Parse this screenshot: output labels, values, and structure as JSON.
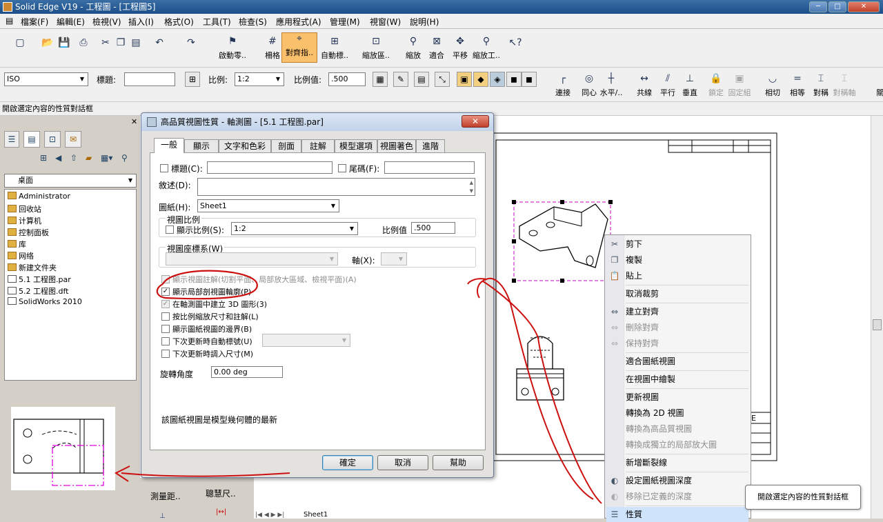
{
  "window": {
    "title": "Solid Edge V19 - 工程圖 - [工程圖5]",
    "min": "─",
    "max": "□",
    "close": "✕"
  },
  "menu": [
    "檔案(F)",
    "編輯(E)",
    "檢視(V)",
    "插入(I)",
    "格式(O)",
    "工具(T)",
    "檢查(S)",
    "應用程式(A)",
    "管理(M)",
    "視窗(W)",
    "說明(H)"
  ],
  "toolbar1": [
    {
      "label": "啟動零..",
      "icon": "start-part-icon"
    },
    {
      "label": "柵格",
      "icon": "grid-icon"
    },
    {
      "label": "對齊指..",
      "icon": "align-icon"
    },
    {
      "label": "自動標..",
      "icon": "auto-label-icon"
    },
    {
      "label": "縮放區..",
      "icon": "zoom-area-icon"
    },
    {
      "label": "縮放",
      "icon": "zoom-icon"
    },
    {
      "label": "適合",
      "icon": "fit-icon"
    },
    {
      "label": "平移",
      "icon": "pan-icon"
    },
    {
      "label": "縮放工..",
      "icon": "zoom-tool-icon"
    }
  ],
  "toolbar2": {
    "standard": "ISO",
    "title_label": "標題:",
    "title_value": "",
    "scale_label": "比例:",
    "scale_value": "1:2",
    "scale_num_label": "比例值:",
    "scale_num_value": ".500"
  },
  "constraints": [
    {
      "label": "連接",
      "glyph": "┌",
      "disabled": false
    },
    {
      "label": "同心",
      "glyph": "◎",
      "disabled": false
    },
    {
      "label": "水平/..",
      "glyph": "┼",
      "disabled": false
    },
    {
      "label": "共線",
      "glyph": "↔",
      "disabled": false
    },
    {
      "label": "平行",
      "glyph": "⫽",
      "disabled": false
    },
    {
      "label": "垂直",
      "glyph": "⊥",
      "disabled": false
    },
    {
      "label": "鎖定",
      "glyph": "🔒",
      "disabled": true
    },
    {
      "label": "固定組",
      "glyph": "▣",
      "disabled": true
    },
    {
      "label": "相切",
      "glyph": "◡",
      "disabled": false
    },
    {
      "label": "相等",
      "glyph": "=",
      "disabled": false
    },
    {
      "label": "對稱",
      "glyph": "⌶",
      "disabled": false
    },
    {
      "label": "對稱軸",
      "glyph": "⌶",
      "disabled": true
    },
    {
      "label": "關(",
      "glyph": "",
      "disabled": false
    }
  ],
  "status": "開啟選定內容的性質對話框",
  "left": {
    "location": "桌面",
    "files": [
      "Administrator",
      "回收站",
      "计算机",
      "控制面板",
      "库",
      "网络",
      "新建文件夹",
      "5.1 工程图.par",
      "5.2 工程图.dft",
      "SolidWorks 2010"
    ]
  },
  "bottomtools": {
    "measure": "測量距..",
    "smart": "聰慧尺.."
  },
  "sheet_tab": "Sheet1",
  "dialog": {
    "title": "高品質視圖性質 - 軸測圖 - [5.1 工程图.par]",
    "tabs": [
      "一般",
      "顯示",
      "文字和色彩",
      "剖面",
      "註解",
      "模型選項",
      "視圖著色",
      "進階"
    ],
    "title_chk": "標題(C):",
    "suffix_chk": "尾碼(F):",
    "desc_label": "敘述(D):",
    "sheet_label": "圖紙(H):",
    "sheet_value": "Sheet1",
    "view_scale_group": "視圖比例",
    "show_scale": "顯示比例(S):",
    "view_scale_value": "1:2",
    "scale_value_label": "比例值",
    "scale_value": ".500",
    "coord_group": "視圖座標系(W)",
    "axis_label": "軸(X):",
    "opt_annot": "顯示視圖註解(切割平面、局部放大區域、檢視平面)(A)",
    "opt_local": "顯示局部剖視圖輪廓(P)",
    "opt_3d": "在軸測圖中建立 3D 圖形(3)",
    "opt_scale": "按比例縮放尺寸和註解(L)",
    "opt_border": "顯示圖紙視圖的邊界(B)",
    "opt_auto": "下次更新時自動標號(U)",
    "opt_dim": "下次更新時調入尺寸(M)",
    "rotate_label": "旋轉角度",
    "rotate_value": "0.00 deg",
    "info": "該圖紙視圖是模型幾何體的最新",
    "ok": "確定",
    "cancel": "取消",
    "help": "幫助",
    "close_glyph": "✕"
  },
  "context_menu": [
    {
      "label": "剪下",
      "icon": "scissors-icon",
      "glyph": "✂",
      "disabled": false
    },
    {
      "label": "複製",
      "icon": "copy-icon",
      "glyph": "❐",
      "disabled": false
    },
    {
      "label": "貼上",
      "icon": "paste-icon",
      "glyph": "📋",
      "disabled": false
    },
    {
      "sep": true
    },
    {
      "label": "取消裁剪",
      "disabled": false
    },
    {
      "sep": true
    },
    {
      "label": "建立對齊",
      "icon": "create-align-icon",
      "glyph": "⇔",
      "disabled": false
    },
    {
      "label": "刪除對齊",
      "icon": "delete-align-icon",
      "glyph": "⇔",
      "disabled": true
    },
    {
      "label": "保持對齊",
      "icon": "keep-align-icon",
      "glyph": "⇔",
      "disabled": true
    },
    {
      "sep": true
    },
    {
      "label": "適合圖紙視圖",
      "disabled": false
    },
    {
      "sep": true
    },
    {
      "label": "在視圖中繪製",
      "disabled": false
    },
    {
      "sep": true
    },
    {
      "label": "更新視圖",
      "disabled": false
    },
    {
      "label": "轉換為 2D 視圖",
      "disabled": false
    },
    {
      "label": "轉換為高品質視圖",
      "disabled": true
    },
    {
      "label": "轉換成獨立的局部放大圖",
      "disabled": true
    },
    {
      "sep": true
    },
    {
      "label": "新增斷裂線",
      "disabled": false
    },
    {
      "sep": true
    },
    {
      "label": "設定圖紙視圖深度",
      "icon": "depth-icon",
      "glyph": "◐",
      "disabled": false
    },
    {
      "label": "移除已定義的深度",
      "icon": "remove-depth-icon",
      "glyph": "◐",
      "disabled": true
    },
    {
      "sep": true
    },
    {
      "label": "性質",
      "icon": "properties-icon",
      "glyph": "☰",
      "disabled": false
    }
  ],
  "tooltip": "開啟選定內容的性質對話框",
  "title_block_letter": "E",
  "annotation_color": "#cc1010"
}
